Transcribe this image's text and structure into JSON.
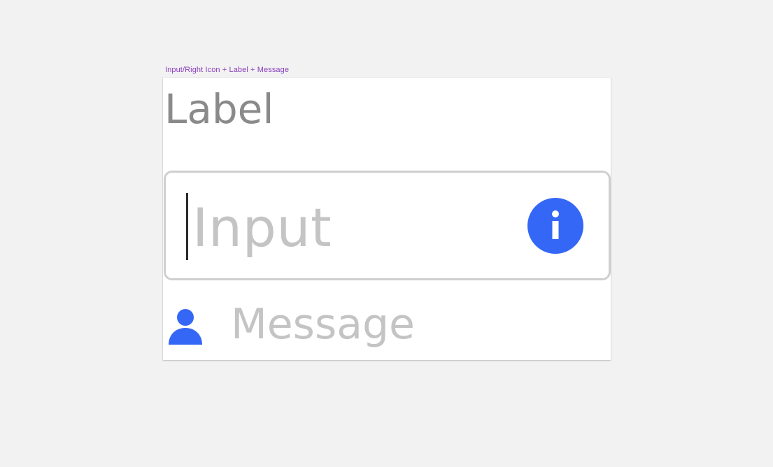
{
  "frame": {
    "caption": "Input/Right Icon + Label + Message"
  },
  "field": {
    "label": "Label",
    "input_placeholder": "Input",
    "message": "Message",
    "right_icon": "info-icon",
    "message_icon": "user-icon"
  },
  "colors": {
    "accent": "#3567f6",
    "label_text": "#8a8a8a",
    "placeholder_text": "#c4c4c4",
    "border": "#cfcfcf",
    "caption": "#8a3fbf",
    "canvas_background": "#f2f2f2"
  }
}
